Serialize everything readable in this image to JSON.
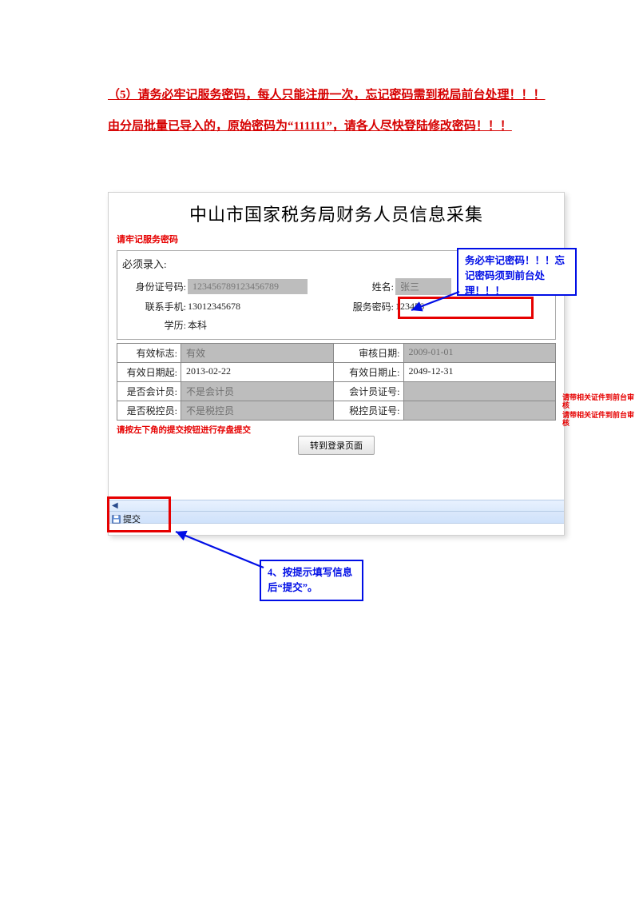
{
  "doc_text": "（5）请务必牢记服务密码，每人只能注册一次，忘记密码需到税局前台处理！！！由分局批量已导入的，原始密码为“111111”，请各人尽快登陆修改密码！！！",
  "app_title": "中山市国家税务局财务人员信息采集",
  "notes": {
    "remember_pwd": "请牢记服务密码",
    "must_input": "必须录入:",
    "submit_hint": "请按左下角的提交按钮进行存盘提交",
    "cert_note": "请带相关证件到前台审核"
  },
  "labels": {
    "id": "身份证号码:",
    "name": "姓名:",
    "phone": "联系手机:",
    "service_pwd": "服务密码:",
    "education": "学历:",
    "valid_flag": "有效标志:",
    "review_date": "审核日期:",
    "valid_from": "有效日期起:",
    "valid_to": "有效日期止:",
    "is_accountant": "是否会计员:",
    "accountant_cert": "会计员证号:",
    "is_taxctrl": "是否税控员:",
    "taxctrl_cert": "税控员证号:"
  },
  "values": {
    "id": "123456789123456789",
    "name": "张三",
    "phone": "13012345678",
    "service_pwd": "123456",
    "education": "本科",
    "valid_flag": "有效",
    "review_date": "2009-01-01",
    "valid_from": "2013-02-22",
    "valid_to": "2049-12-31",
    "is_accountant": "不是会计员",
    "accountant_cert": "",
    "is_taxctrl": "不是税控员",
    "taxctrl_cert": ""
  },
  "buttons": {
    "to_login": "转到登录页面",
    "submit": "提交"
  },
  "callouts": {
    "pwd": "务必牢记密码！！！忘记密码须到前台处理！！！",
    "submit": "4、按提示填写信息后“提交”。"
  }
}
